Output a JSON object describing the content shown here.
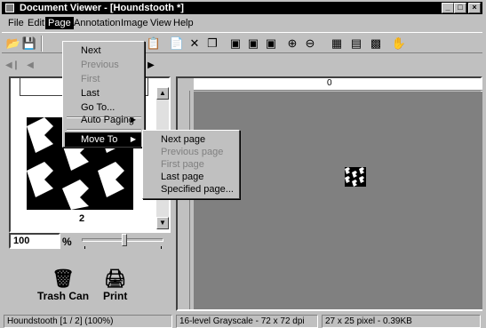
{
  "window": {
    "title": "Document Viewer - [Houndstooth *]",
    "controls": [
      "_",
      "□",
      "×"
    ]
  },
  "menubar": [
    {
      "label": "File"
    },
    {
      "label": "Edit"
    },
    {
      "label": "Page",
      "active": true
    },
    {
      "label": "Annotation"
    },
    {
      "label": "Image"
    },
    {
      "label": "View"
    },
    {
      "label": "Help"
    }
  ],
  "toolbar_icons": [
    "open-icon",
    "save-icon",
    "delete-icon",
    "copy-icon",
    "zoom-in-icon",
    "zoom-out-icon",
    "hand-icon"
  ],
  "page_menu": {
    "items": [
      {
        "label": "Next",
        "enabled": true
      },
      {
        "label": "Previous",
        "enabled": false
      },
      {
        "label": "First",
        "enabled": false
      },
      {
        "label": "Last",
        "enabled": true
      },
      {
        "label": "Go To...",
        "enabled": true
      },
      {
        "label": "Auto Paging",
        "enabled": true,
        "submenu": true
      },
      {
        "label": "Move To",
        "enabled": true,
        "submenu": true,
        "selected": true
      }
    ]
  },
  "move_to_menu": {
    "items": [
      {
        "label": "Next page",
        "enabled": true
      },
      {
        "label": "Previous page",
        "enabled": false
      },
      {
        "label": "First page",
        "enabled": false
      },
      {
        "label": "Last page",
        "enabled": true
      },
      {
        "label": "Specified page...",
        "enabled": true
      }
    ]
  },
  "thumbnail": {
    "page_label": "2"
  },
  "zoom": {
    "value": "100",
    "unit": "%",
    "slider_level": 0.5
  },
  "ruler": {
    "top_label": "0"
  },
  "bottom_icons": {
    "trash_label": "Trash Can",
    "print_label": "Print"
  },
  "status": {
    "doc": "Houndstooth [1 / 2] (100%)",
    "color": "16-level Grayscale - 72 x 72 dpi",
    "size": "27 x 25 pixel - 0.39KB"
  }
}
